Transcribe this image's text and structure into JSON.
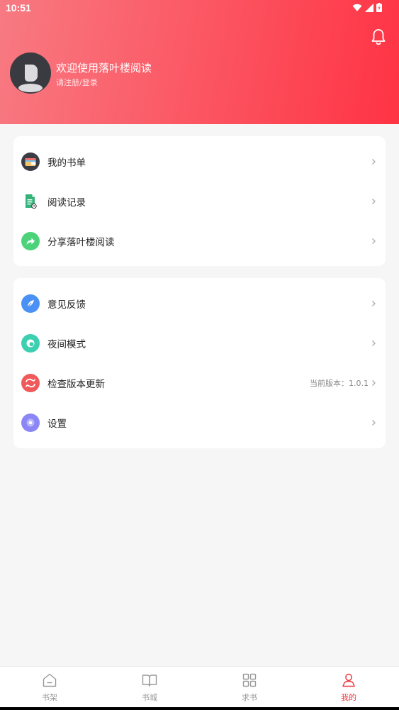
{
  "status_bar": {
    "time": "10:51"
  },
  "profile": {
    "welcome_text": "欢迎使用落叶楼阅读",
    "login_text": "请注册/登录"
  },
  "menu_group_1": [
    {
      "label": "我的书单",
      "icon": "wallet-icon",
      "color": "#3c3c44"
    },
    {
      "label": "阅读记录",
      "icon": "document-icon",
      "color": "#3cb878"
    },
    {
      "label": "分享落叶楼阅读",
      "icon": "share-icon",
      "color": "#4cd37a"
    }
  ],
  "menu_group_2": [
    {
      "label": "意见反馈",
      "icon": "feather-icon",
      "color": "#4a90f5"
    },
    {
      "label": "夜间模式",
      "icon": "moon-icon",
      "color": "#3ccfb0"
    },
    {
      "label": "检查版本更新",
      "icon": "refresh-icon",
      "color": "#f05a5a",
      "extra": "当前版本：1.0.1"
    },
    {
      "label": "设置",
      "icon": "gear-icon",
      "color": "#8b86f5"
    }
  ],
  "tabs": [
    {
      "label": "书架",
      "icon": "home-icon",
      "active": false
    },
    {
      "label": "书城",
      "icon": "book-icon",
      "active": false
    },
    {
      "label": "求书",
      "icon": "grid-icon",
      "active": false
    },
    {
      "label": "我的",
      "icon": "user-icon",
      "active": true
    }
  ],
  "colors": {
    "header_start": "#f87a82",
    "header_end": "#ff3344",
    "active_tab": "#ee3a43"
  }
}
